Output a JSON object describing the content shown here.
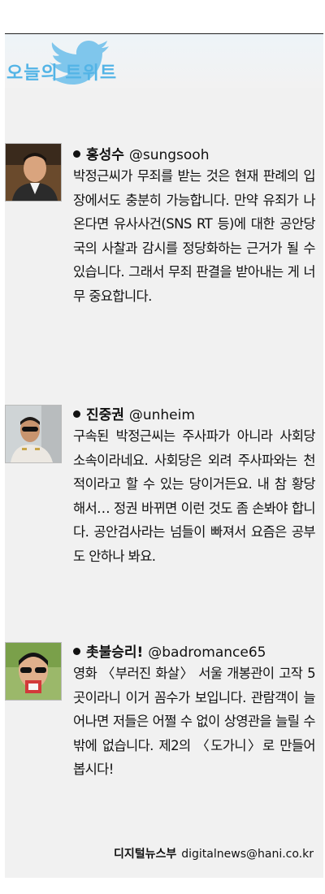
{
  "header": {
    "title": "오늘의 트위트"
  },
  "tweets": [
    {
      "name": "홍성수",
      "handle": "@sungsooh",
      "text": "박정근씨가 무죄를 받는 것은 현재 판례의 입장에서도 충분히 가능합니다. 만약 유죄가 나온다면 유사사건(SNS RT 등)에 대한 공안당국의 사찰과 감시를 정당화하는 근거가 될 수 있습니다. 그래서 무죄 판결을 받아내는 게 너무 중요합니다."
    },
    {
      "name": "진중권",
      "handle": "@unheim",
      "text": "구속된 박정근씨는 주사파가 아니라 사회당 소속이라네요. 사회당은 외려 주사파와는 천적이라고 할 수 있는 당이거든요. 내 참 황당해서… 정권 바뀌면 이런 것도 좀 손봐야 합니다. 공안검사라는 넘들이 빠져서 요즘은 공부도 안하나 봐요."
    },
    {
      "name": "촛불승리!",
      "handle": "@badromance65",
      "text": "영화 〈부러진 화살〉 서울 개봉관이 고작 5곳이라니 이거 꼼수가 보입니다. 관람객이 늘어나면 저들은 어쩔 수 없이 상영관을 늘릴 수밖에 없습니다. 제2의 〈도가니〉로 만들어 봅시다!"
    }
  ],
  "credit": {
    "dept": "디지털뉴스부",
    "email": "digitalnews@hani.co.kr"
  },
  "colors": {
    "title": "#53b4e6",
    "panel": "#f1f1f1",
    "bird": "#7fc6ec"
  }
}
